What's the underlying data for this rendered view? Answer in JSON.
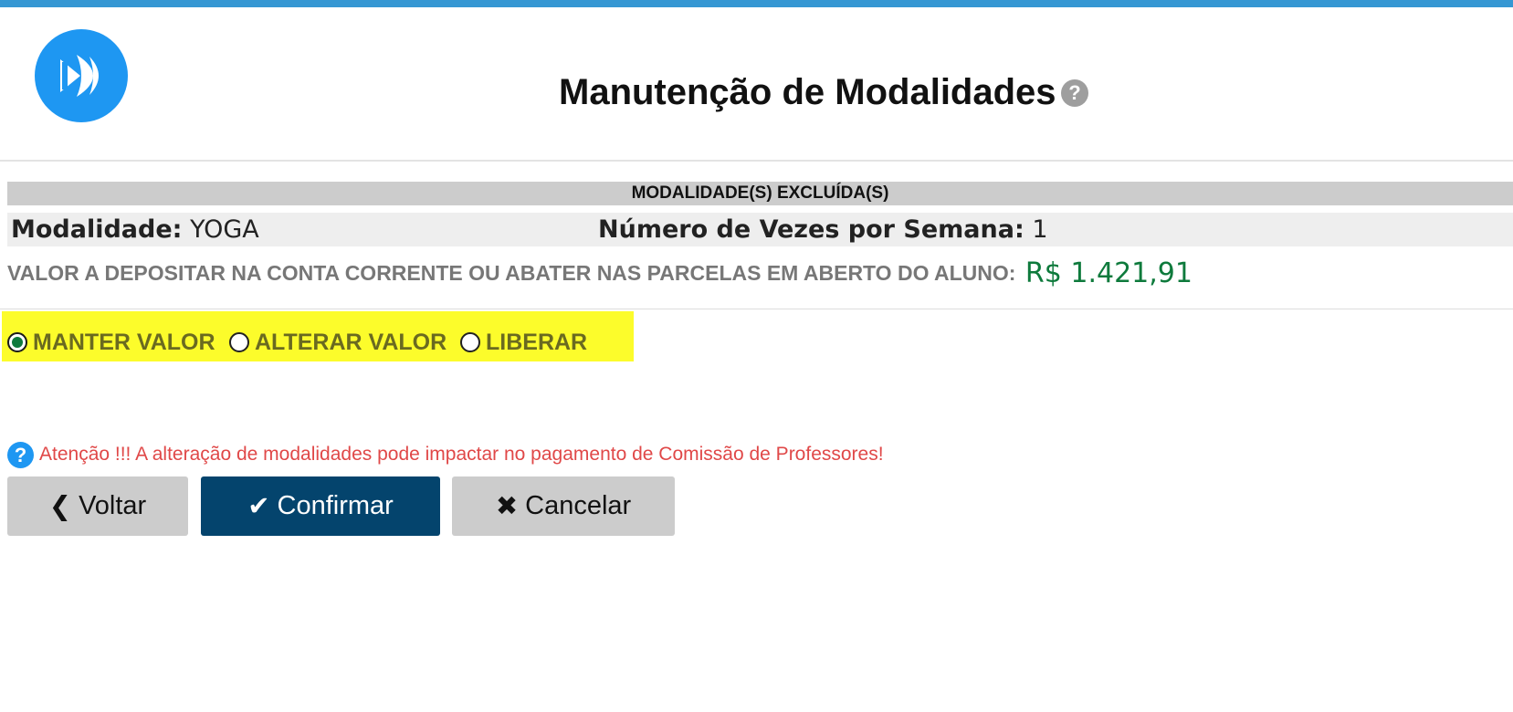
{
  "colors": {
    "top_bar": "#3597d3",
    "logo": "#1e97f2",
    "highlight": "#fcfc2b",
    "amount": "#0e7a3c",
    "alert_text": "#e04848",
    "primary_button": "#04446d",
    "secondary_button": "#cccccc"
  },
  "header": {
    "logo_icon": "fast-forward-logo-icon",
    "title": "Manutenção de Modalidades",
    "help_icon": "question-circle-icon",
    "help_glyph": "?"
  },
  "section": {
    "title": "MODALIDADE(S) EXCLUÍDA(S)"
  },
  "modalidade": {
    "label": "Modalidade:",
    "value": "YOGA",
    "vezes_label": "Número de Vezes por Semana:",
    "vezes_value": "1"
  },
  "valor": {
    "label": "VALOR A DEPOSITAR NA CONTA CORRENTE OU ABATER NAS PARCELAS EM ABERTO DO ALUNO:",
    "amount": "R$ 1.421,91"
  },
  "options": {
    "selected": "MANTER VALOR",
    "items": [
      {
        "label": "MANTER VALOR",
        "checked": true
      },
      {
        "label": "ALTERAR VALOR",
        "checked": false
      },
      {
        "label": "LIBERAR",
        "checked": false
      }
    ]
  },
  "alert": {
    "icon": "question-circle-icon",
    "glyph": "?",
    "text": "Atenção !!! A alteração de modalidades pode impactar no pagamento de Comissão de Professores!"
  },
  "buttons": {
    "voltar": {
      "label": "Voltar",
      "icon": "chevron-left-icon",
      "glyph": "❮"
    },
    "confirmar": {
      "label": "Confirmar",
      "icon": "check-icon",
      "glyph": "✔"
    },
    "cancelar": {
      "label": "Cancelar",
      "icon": "close-icon",
      "glyph": "✖"
    }
  }
}
